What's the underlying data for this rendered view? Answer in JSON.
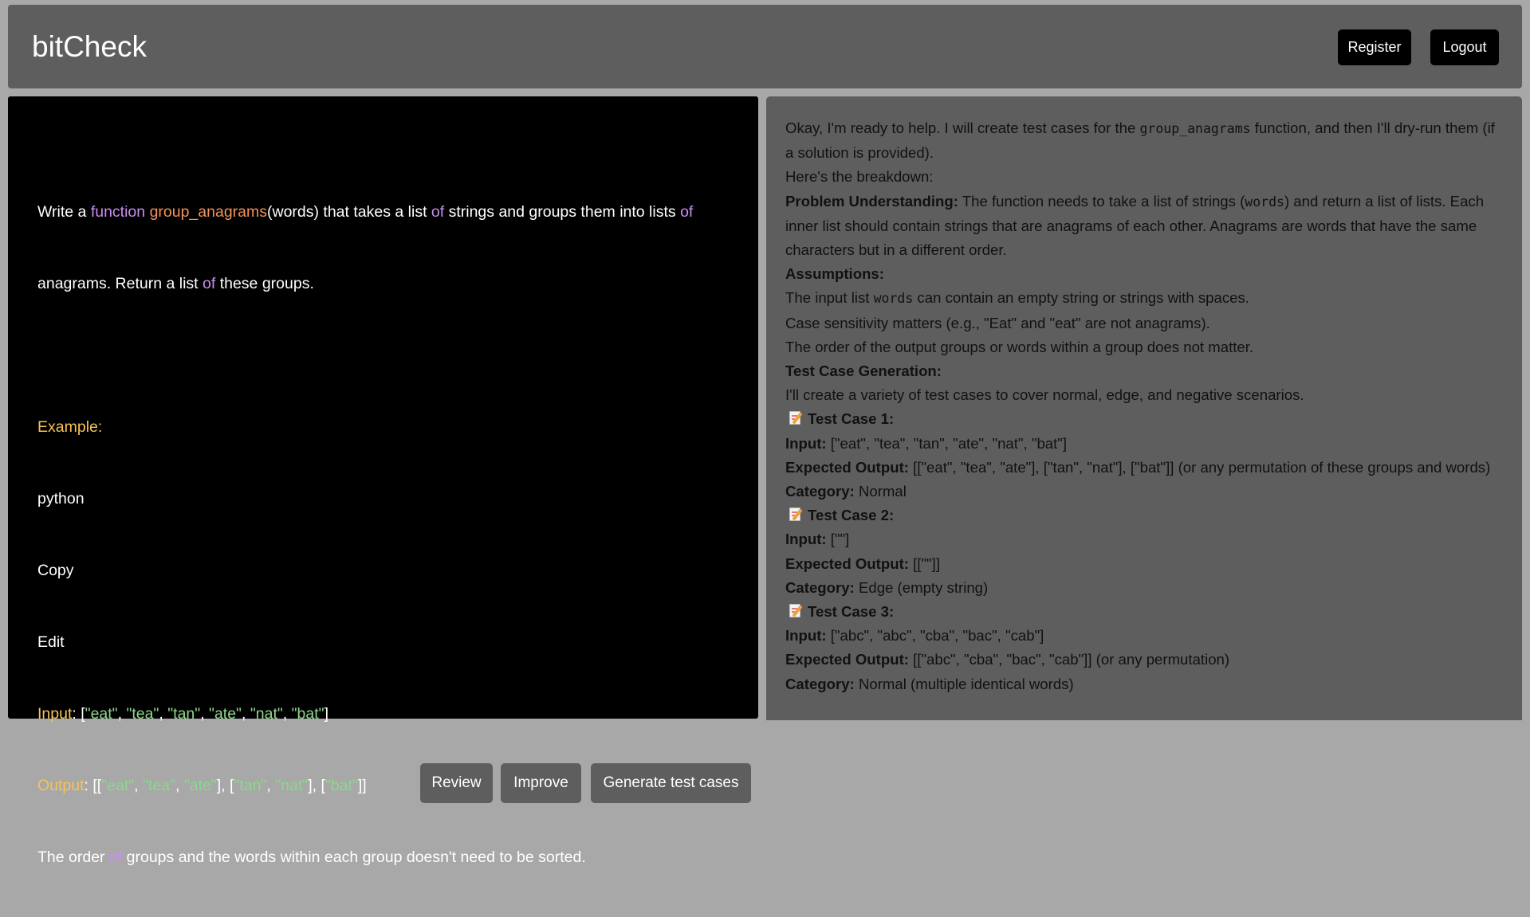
{
  "header": {
    "brand": "bitCheck",
    "register_label": "Register",
    "logout_label": "Logout"
  },
  "editor": {
    "line1": {
      "t1": "Write a ",
      "t2": "function",
      "t3": " ",
      "t4": "group_anagrams",
      "t5": "(words) that takes a list ",
      "t6": "of",
      "t7": " strings and groups them into lists ",
      "t8": "of"
    },
    "line2": {
      "t1": "anagrams. Return a list ",
      "t2": "of",
      "t3": " these groups."
    },
    "example_label": "Example:",
    "lang_line": "python",
    "copy_line": "Copy",
    "edit_line": "Edit",
    "input_line": {
      "label": "Input",
      "colon": ": [",
      "items": [
        "\"eat\"",
        "\"tea\"",
        "\"tan\"",
        "\"ate\"",
        "\"nat\"",
        "\"bat\""
      ],
      "sep": ", ",
      "close": "]"
    },
    "output_line": {
      "label": "Output",
      "colon": ": [[",
      "g1": [
        "\"eat\"",
        "\"tea\"",
        "\"ate\""
      ],
      "mid1": "], [",
      "g2": [
        "\"tan\"",
        "\"nat\""
      ],
      "mid2": "], [",
      "g3": [
        "\"bat\""
      ],
      "close": "]]",
      "sep": ", "
    },
    "last_line": {
      "t1": "The order ",
      "t2": "of",
      "t3": " groups and the words within each group doesn't need to be sorted."
    },
    "buttons": {
      "review": "Review",
      "improve": "Improve",
      "generate": "Generate test cases"
    }
  },
  "response": {
    "intro_a": "Okay, I'm ready to help. I will create test cases for the ",
    "intro_code": "group_anagrams",
    "intro_b": " function, and then I'll dry-run them (if a solution is provided).",
    "breakdown": "Here's the breakdown:",
    "pu_label": "Problem Understanding:",
    "pu_a": " The function needs to take a list of strings (",
    "pu_code": "words",
    "pu_b": ") and return a list of lists. Each inner list should contain strings that are anagrams of each other. Anagrams are words that have the same characters but in a different order.",
    "assumptions_label": "Assumptions:",
    "as1_a": "The input list ",
    "as1_code": "words",
    "as1_b": " can contain an empty string or strings with spaces.",
    "as2": "Case sensitivity matters (e.g., \"Eat\" and \"eat\" are not anagrams).",
    "as3": "The order of the output groups or words within a group does not matter.",
    "tcg_label": "Test Case Generation:",
    "tcg_text": "I'll create a variety of test cases to cover normal, edge, and negative scenarios.",
    "input_label": "Input:",
    "expected_label": "Expected Output:",
    "category_label": "Category:",
    "test_cases": [
      {
        "title": "Test Case 1:",
        "input": " [\"eat\", \"tea\", \"tan\", \"ate\", \"nat\", \"bat\"]",
        "expected": " [[\"eat\", \"tea\", \"ate\"], [\"tan\", \"nat\"], [\"bat\"]] (or any permutation of these groups and words)",
        "category": " Normal"
      },
      {
        "title": "Test Case 2:",
        "input": " [\"\"]",
        "expected": " [[\"\"]]",
        "category": " Edge (empty string)"
      },
      {
        "title": "Test Case 3:",
        "input": " [\"abc\", \"abc\", \"cba\", \"bac\", \"cab\"]",
        "expected": " [[\"abc\", \"cba\", \"bac\", \"cab\"]] (or any permutation)",
        "category": " Normal (multiple identical words)"
      }
    ]
  },
  "colors": {
    "keyword": "#cb8df0",
    "function_name": "#f2925a",
    "label": "#f6c256",
    "string": "#8ed68e",
    "panel_bg": "#5e5e5e",
    "editor_bg": "#000000"
  },
  "icons": {
    "test_case": "memo-icon"
  }
}
